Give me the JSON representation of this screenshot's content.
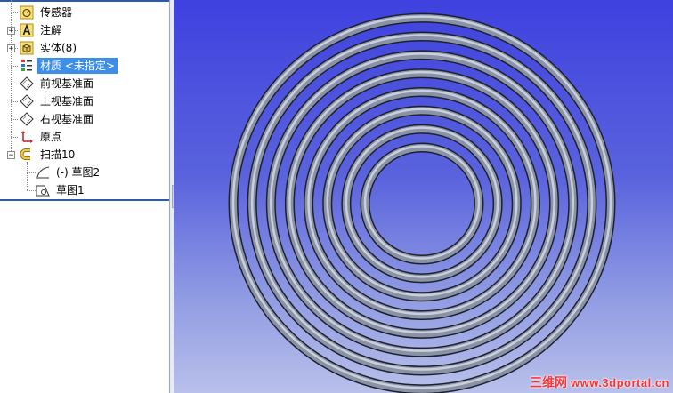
{
  "tree": {
    "items": [
      {
        "label": "传感器",
        "icon": "sensor-icon"
      },
      {
        "label": "注解",
        "icon": "annotation-icon"
      },
      {
        "label": "实体(8)",
        "icon": "solid-bodies-icon"
      },
      {
        "label": "材质 <未指定>",
        "icon": "material-icon"
      },
      {
        "label": "前视基准面",
        "icon": "plane-icon"
      },
      {
        "label": "上视基准面",
        "icon": "plane-icon"
      },
      {
        "label": "右视基准面",
        "icon": "plane-icon"
      },
      {
        "label": "原点",
        "icon": "origin-icon"
      },
      {
        "label": "扫描10",
        "icon": "sweep-feature-icon"
      },
      {
        "label": "(-) 草图2",
        "icon": "sketch-icon"
      },
      {
        "label": "草图1",
        "icon": "sketch-icon"
      }
    ]
  },
  "colors": {
    "selection": "#3d8ee8",
    "viewport_top": "#3f41df",
    "viewport_bottom": "#b9c0ea",
    "ring": "#8a93a6"
  },
  "viewport": {
    "ring_count": 8
  },
  "watermark": {
    "cn": "三维网",
    "url": "www.3dportal.cn"
  }
}
